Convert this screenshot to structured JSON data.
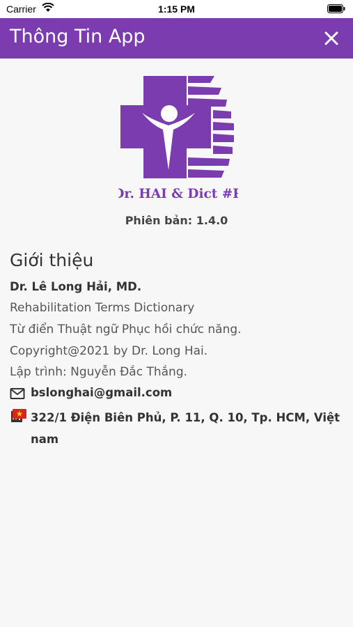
{
  "status_bar": {
    "carrier": "Carrier",
    "time": "1:15 PM"
  },
  "app_bar": {
    "title": "Thông Tin App"
  },
  "logo": {
    "caption": "Dr. HAI & Dict #R"
  },
  "version": {
    "text": "Phiên bản: 1.4.0"
  },
  "intro": {
    "title": "Giới thiệu",
    "author": "Dr. Lê Long Hải, MD.",
    "app_name_en": "Rehabilitation Terms Dictionary",
    "app_name_vi": "Từ điển Thuật ngữ Phục hồi chức năng.",
    "copyright": "Copyright@2021 by Dr. Long Hai.",
    "developer": "Lập trình: Nguyễn Đắc Thắng."
  },
  "contact": {
    "email": "bslonghai@gmail.com",
    "address": "322/1 Điện Biên Phủ, P. 11, Q. 10, Tp. HCM, Việt nam"
  },
  "colors": {
    "brand": "#7b3cb0",
    "background": "#f7f7f7"
  },
  "icons": [
    "wifi-icon",
    "battery-icon",
    "close-icon",
    "mail-icon",
    "building-icon",
    "vietnam-flag-icon"
  ]
}
